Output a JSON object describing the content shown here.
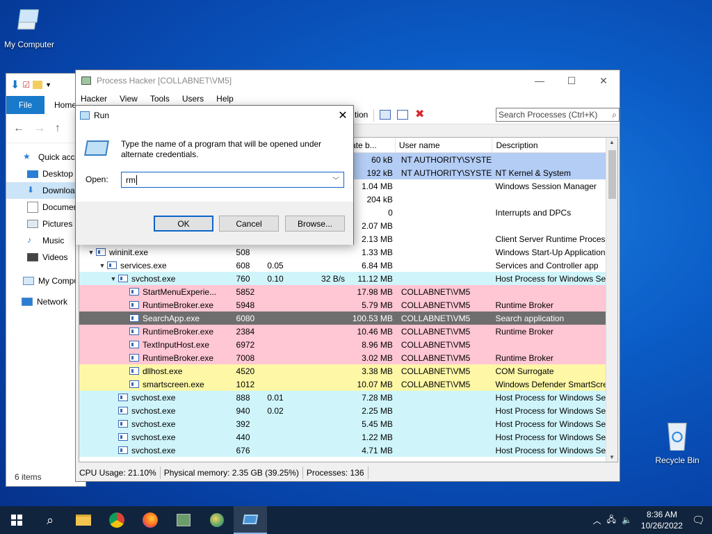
{
  "desktop": {
    "icons": [
      {
        "label": "My Computer"
      },
      {
        "label": "Recycle Bin"
      }
    ]
  },
  "explorer": {
    "tabs": {
      "file": "File",
      "home": "Home"
    },
    "sidebar": [
      {
        "label": "Quick access",
        "icon": "star-icon"
      },
      {
        "label": "Desktop",
        "icon": "desktop-icon"
      },
      {
        "label": "Downloads",
        "icon": "download-icon"
      },
      {
        "label": "Documents",
        "icon": "document-icon"
      },
      {
        "label": "Pictures",
        "icon": "pictures-icon"
      },
      {
        "label": "Music",
        "icon": "music-icon"
      },
      {
        "label": "Videos",
        "icon": "videos-icon"
      },
      {
        "label": "My Computer",
        "icon": "computer-icon"
      },
      {
        "label": "Network",
        "icon": "network-icon"
      }
    ],
    "status": "6 items"
  },
  "process_hacker": {
    "title": "Process Hacker [COLLABNET\\VM5]",
    "menu": [
      "Hacker",
      "View",
      "Tools",
      "Users",
      "Help"
    ],
    "toolbar_partial": "tion",
    "search_placeholder": "Search Processes (Ctrl+K)",
    "columns": {
      "private_bytes": "ate b...",
      "user": "User name",
      "desc": "Description"
    },
    "rows": [
      {
        "indent": 0,
        "tw": "",
        "name": "",
        "pid": "",
        "cpu": "",
        "io": "",
        "mem": "60 kB",
        "user": "NT AUTHORITY\\SYSTEM",
        "desc": "",
        "bg": "#b4cdf5"
      },
      {
        "indent": 0,
        "tw": "",
        "name": "",
        "pid": "",
        "cpu": "",
        "io": "",
        "mem": "192 kB",
        "user": "NT AUTHORITY\\SYSTEM",
        "desc": "NT Kernel & System",
        "bg": "#b4cdf5"
      },
      {
        "indent": 0,
        "tw": "",
        "name": "",
        "pid": "",
        "cpu": "",
        "io": "",
        "mem": "1.04 MB",
        "user": "",
        "desc": "Windows Session Manager",
        "bg": "#ffffff"
      },
      {
        "indent": 0,
        "tw": "",
        "name": "",
        "pid": "",
        "cpu": "",
        "io": "",
        "mem": "204 kB",
        "user": "",
        "desc": "",
        "bg": "#ffffff"
      },
      {
        "indent": 0,
        "tw": "",
        "name": "",
        "pid": "",
        "cpu": "",
        "io": "",
        "mem": "0",
        "user": "",
        "desc": "Interrupts and DPCs",
        "bg": "#ffffff"
      },
      {
        "indent": 0,
        "tw": "",
        "name": "",
        "pid": "",
        "cpu": "",
        "io": "",
        "mem": "2.07 MB",
        "user": "",
        "desc": "",
        "bg": "#ffffff"
      },
      {
        "indent": 0,
        "tw": "",
        "name": "",
        "pid": "",
        "cpu": "",
        "io": "",
        "mem": "2.13 MB",
        "user": "",
        "desc": "Client Server Runtime Process",
        "bg": "#ffffff"
      },
      {
        "indent": 0,
        "tw": "▼",
        "name": "wininit.exe",
        "pid": "508",
        "cpu": "",
        "io": "",
        "mem": "1.33 MB",
        "user": "",
        "desc": "Windows Start-Up Application",
        "bg": "#ffffff"
      },
      {
        "indent": 1,
        "tw": "▼",
        "name": "services.exe",
        "pid": "608",
        "cpu": "0.05",
        "io": "",
        "mem": "6.84 MB",
        "user": "",
        "desc": "Services and Controller app",
        "bg": "#ffffff"
      },
      {
        "indent": 2,
        "tw": "▼",
        "name": "svchost.exe",
        "pid": "760",
        "cpu": "0.10",
        "io": "32 B/s",
        "mem": "11.12 MB",
        "user": "",
        "desc": "Host Process for Windows Ser...",
        "bg": "#cff5fb"
      },
      {
        "indent": 3,
        "tw": "",
        "name": "StartMenuExperie...",
        "pid": "5852",
        "cpu": "",
        "io": "",
        "mem": "17.98 MB",
        "user": "COLLABNET\\VM5",
        "desc": "",
        "bg": "#ffc6d4"
      },
      {
        "indent": 3,
        "tw": "",
        "name": "RuntimeBroker.exe",
        "pid": "5948",
        "cpu": "",
        "io": "",
        "mem": "5.79 MB",
        "user": "COLLABNET\\VM5",
        "desc": "Runtime Broker",
        "bg": "#ffc6d4"
      },
      {
        "indent": 3,
        "tw": "",
        "name": "SearchApp.exe",
        "pid": "6080",
        "cpu": "",
        "io": "",
        "mem": "100.53 MB",
        "user": "COLLABNET\\VM5",
        "desc": "Search application",
        "bg": "#6e6e6e"
      },
      {
        "indent": 3,
        "tw": "",
        "name": "RuntimeBroker.exe",
        "pid": "2384",
        "cpu": "",
        "io": "",
        "mem": "10.46 MB",
        "user": "COLLABNET\\VM5",
        "desc": "Runtime Broker",
        "bg": "#ffc6d4"
      },
      {
        "indent": 3,
        "tw": "",
        "name": "TextInputHost.exe",
        "pid": "6972",
        "cpu": "",
        "io": "",
        "mem": "8.96 MB",
        "user": "COLLABNET\\VM5",
        "desc": "",
        "bg": "#ffc6d4"
      },
      {
        "indent": 3,
        "tw": "",
        "name": "RuntimeBroker.exe",
        "pid": "7008",
        "cpu": "",
        "io": "",
        "mem": "3.02 MB",
        "user": "COLLABNET\\VM5",
        "desc": "Runtime Broker",
        "bg": "#ffc6d4"
      },
      {
        "indent": 3,
        "tw": "",
        "name": "dllhost.exe",
        "pid": "4520",
        "cpu": "",
        "io": "",
        "mem": "3.38 MB",
        "user": "COLLABNET\\VM5",
        "desc": "COM Surrogate",
        "bg": "#fdf7a6"
      },
      {
        "indent": 3,
        "tw": "",
        "name": "smartscreen.exe",
        "pid": "1012",
        "cpu": "",
        "io": "",
        "mem": "10.07 MB",
        "user": "COLLABNET\\VM5",
        "desc": "Windows Defender SmartScre...",
        "bg": "#fdf7a6"
      },
      {
        "indent": 2,
        "tw": "",
        "name": "svchost.exe",
        "pid": "888",
        "cpu": "0.01",
        "io": "",
        "mem": "7.28 MB",
        "user": "",
        "desc": "Host Process for Windows Ser...",
        "bg": "#cff5fb"
      },
      {
        "indent": 2,
        "tw": "",
        "name": "svchost.exe",
        "pid": "940",
        "cpu": "0.02",
        "io": "",
        "mem": "2.25 MB",
        "user": "",
        "desc": "Host Process for Windows Ser...",
        "bg": "#cff5fb"
      },
      {
        "indent": 2,
        "tw": "",
        "name": "svchost.exe",
        "pid": "392",
        "cpu": "",
        "io": "",
        "mem": "5.45 MB",
        "user": "",
        "desc": "Host Process for Windows Ser...",
        "bg": "#cff5fb"
      },
      {
        "indent": 2,
        "tw": "",
        "name": "svchost.exe",
        "pid": "440",
        "cpu": "",
        "io": "",
        "mem": "1.22 MB",
        "user": "",
        "desc": "Host Process for Windows Ser...",
        "bg": "#cff5fb"
      },
      {
        "indent": 2,
        "tw": "",
        "name": "svchost.exe",
        "pid": "676",
        "cpu": "",
        "io": "",
        "mem": "4.71 MB",
        "user": "",
        "desc": "Host Process for Windows Ser...",
        "bg": "#cff5fb"
      }
    ],
    "status": {
      "cpu": "CPU Usage: 21.10%",
      "memory": "Physical memory: 2.35 GB (39.25%)",
      "processes": "Processes: 136"
    }
  },
  "run_dialog": {
    "title": "Run",
    "message": "Type the name of a program that will be opened under alternate credentials.",
    "open_label": "Open:",
    "open_value": "rm",
    "ok": "OK",
    "cancel": "Cancel",
    "browse": "Browse..."
  },
  "taskbar": {
    "time": "8:36 AM",
    "date": "10/26/2022"
  }
}
